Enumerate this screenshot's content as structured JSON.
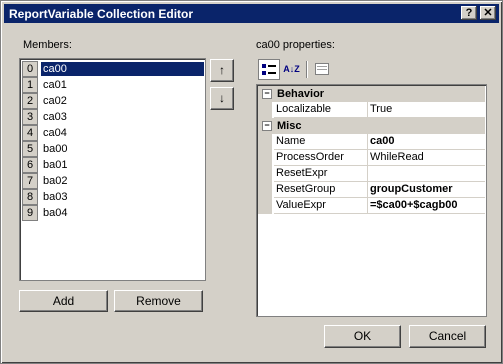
{
  "window": {
    "title": "ReportVariable Collection Editor",
    "help_glyph": "?",
    "close_glyph": "✕"
  },
  "members": {
    "label": "Members:",
    "items": [
      {
        "index": "0",
        "name": "ca00",
        "selected": true
      },
      {
        "index": "1",
        "name": "ca01"
      },
      {
        "index": "2",
        "name": "ca02"
      },
      {
        "index": "3",
        "name": "ca03"
      },
      {
        "index": "4",
        "name": "ca04"
      },
      {
        "index": "5",
        "name": "ba00"
      },
      {
        "index": "6",
        "name": "ba01"
      },
      {
        "index": "7",
        "name": "ba02"
      },
      {
        "index": "8",
        "name": "ba03"
      },
      {
        "index": "9",
        "name": "ba04"
      }
    ],
    "move_up_glyph": "↑",
    "move_down_glyph": "↓",
    "add_label": "Add",
    "remove_label": "Remove"
  },
  "properties": {
    "label": "ca00 properties:",
    "toolbar": {
      "categorized_icon": "categorized-icon",
      "alphabetical_icon": "alphabetical-icon",
      "pages_icon": "property-pages-icon",
      "alpha_glyph": "A↓Z"
    },
    "categories": [
      {
        "name": "Behavior",
        "collapse_glyph": "−",
        "rows": [
          {
            "name": "Localizable",
            "value": "True",
            "bold": false
          }
        ]
      },
      {
        "name": "Misc",
        "collapse_glyph": "−",
        "rows": [
          {
            "name": "Name",
            "value": "ca00",
            "bold": true
          },
          {
            "name": "ProcessOrder",
            "value": "WhileRead",
            "bold": false
          },
          {
            "name": "ResetExpr",
            "value": "",
            "bold": false
          },
          {
            "name": "ResetGroup",
            "value": "groupCustomer",
            "bold": true
          },
          {
            "name": "ValueExpr",
            "value": "=$ca00+$cagb00",
            "bold": true
          }
        ]
      }
    ]
  },
  "footer": {
    "ok_label": "OK",
    "cancel_label": "Cancel"
  }
}
